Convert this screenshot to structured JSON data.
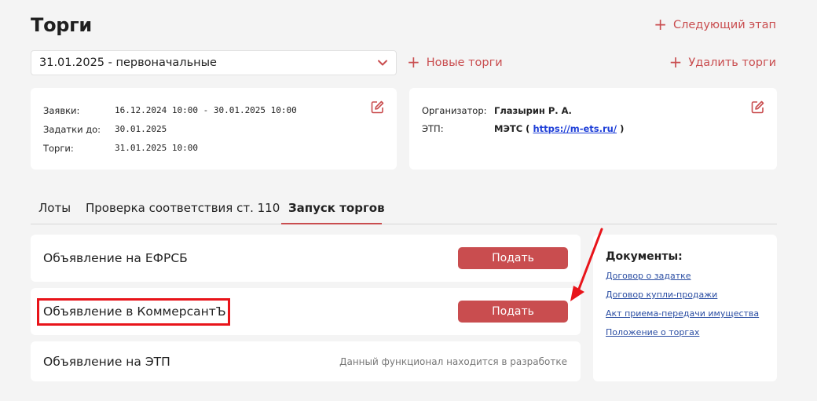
{
  "header": {
    "title": "Торги",
    "next_stage": "Следующий этап",
    "new_trades": "Новые торги",
    "delete_trades": "Удалить торги"
  },
  "select": {
    "value": "31.01.2025 - первоначальные"
  },
  "info_left": {
    "applications_label": "Заявки:",
    "applications_value": "16.12.2024 10:00 - 30.01.2025 10:00",
    "deposits_label": "Задатки до:",
    "deposits_value": "30.01.2025",
    "trades_label": "Торги:",
    "trades_value": "31.01.2025 10:00"
  },
  "info_right": {
    "organizer_label": "Организатор:",
    "organizer_value": "Глазырин Р. А.",
    "etp_label": "ЭТП:",
    "etp_prefix": "МЭТС (",
    "etp_link": "https://m-ets.ru/",
    "etp_suffix": ")"
  },
  "tabs": [
    {
      "label": "Лоты"
    },
    {
      "label": "Проверка соответствия ст. 110"
    },
    {
      "label": "Запуск торгов"
    }
  ],
  "rows": [
    {
      "label": "Объявление на ЕФРСБ",
      "button": "Подать"
    },
    {
      "label": "Объявление в КоммерсантЪ",
      "button": "Подать"
    },
    {
      "label": "Объявление на ЭТП",
      "note": "Данный функционал находится в разработке"
    }
  ],
  "documents": {
    "title": "Документы:",
    "links": [
      "Договор о задатке",
      "Договор купли-продажи",
      "Акт приема-передачи имущества",
      "Положение о торгах"
    ]
  },
  "colors": {
    "accent": "#c94d4f",
    "highlight": "#e8141a",
    "link": "#2b4ea3",
    "background": "#f4f4f4"
  },
  "icons": {
    "plus": "plus-icon",
    "chevron": "chevron-down-icon",
    "edit": "edit-icon",
    "arrow": "annotation-arrow"
  }
}
